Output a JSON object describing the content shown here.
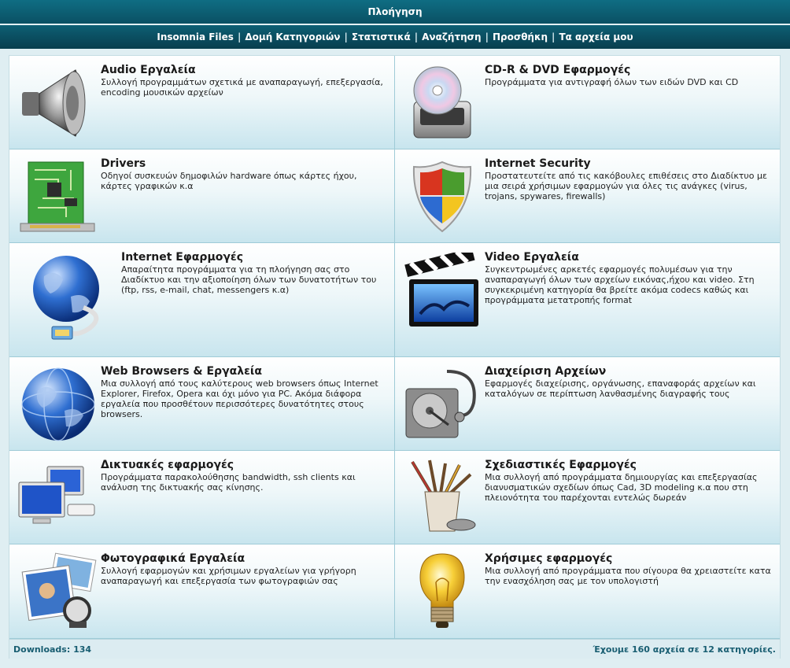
{
  "header": {
    "title": "Πλοήγηση"
  },
  "nav": {
    "items": [
      "Insomnia Files",
      "Δομή Κατηγοριών",
      "Στατιστικά",
      "Αναζήτηση",
      "Προσθήκη",
      "Τα αρχεία μου"
    ]
  },
  "categories": [
    {
      "title": "Audio Εργαλεία",
      "desc": "Συλλογή προγραμμάτων σχετικά με αναπαραγωγή, επεξεργασία, encoding μουσικών αρχείων",
      "icon": "speaker-icon"
    },
    {
      "title": "CD-R & DVD Εφαρμογές",
      "desc": "Προγράμματα για αντιγραφή όλων των ειδών DVD και CD",
      "icon": "cd-burner-icon"
    },
    {
      "title": "Drivers",
      "desc": "Οδηγοί συσκευών δημοφιλών hardware όπως κάρτες ήχου, κάρτες γραφικών κ.α",
      "icon": "circuit-board-icon"
    },
    {
      "title": "Internet Security",
      "desc": "Προστατευτείτε από τις κακόβουλες επιθέσεις στο Διαδίκτυο με μια σειρά χρήσιμων εφαρμογών για όλες τις ανάγκες (virus, trojans, spywares, firewalls)",
      "icon": "shield-icon"
    },
    {
      "title": "Internet Εφαρμογές",
      "desc": "Απαραίτητα προγράμματα για τη πλοήγηση σας στο Διαδίκτυο και την αξιοποίηση όλων των δυνατοτήτων του (ftp, rss, e-mail, chat, messengers κ.α)",
      "icon": "globe-cable-icon"
    },
    {
      "title": "Video Εργαλεία",
      "desc": "Συγκεντρωμένες αρκετές εφαρμογές πολυμέσων για την αναπαραγωγή όλων των αρχείων εικόνας,ήχου και video. Στη συγκεκριμένη κατηγορία θα βρείτε ακόμα codecs καθώς και προγράμματα μετατροπής format",
      "icon": "clapperboard-icon"
    },
    {
      "title": "Web Browsers & Εργαλεία",
      "desc": "Μια συλλογή από τους καλύτερους web browsers όπως Internet Explorer, Firefox, Opera και όχι μόνο για PC. Ακόμα διάφορα εργαλεία που προσθέτουν περισσότερες δυνατότητες στους browsers.",
      "icon": "globe-icon"
    },
    {
      "title": "Διαχείριση Αρχείων",
      "desc": "Εφαρμογές διαχείρισης, οργάνωσης, επαναφοράς αρχείων και καταλόγων σε περίπτωση λανθασμένης διαγραφής τους",
      "icon": "disk-stethoscope-icon"
    },
    {
      "title": "Δικτυακές εφαρμογές",
      "desc": "Προγράμματα παρακολούθησης bandwidth, ssh clients και ανάλυση της δικτυακής σας κίνησης.",
      "icon": "network-computers-icon"
    },
    {
      "title": "Σχεδιαστικές Εφαρμογές",
      "desc": "Μια συλλογή από προγράμματα δημιουργίας και επεξεργασίας διανυσματικών σχεδίων όπως Cad, 3D modeling κ.α που στη πλειονότητα του παρέχονται εντελώς δωρεάν",
      "icon": "pencil-cup-icon"
    },
    {
      "title": "Φωτογραφικά Εργαλεία",
      "desc": "Συλλογή εφαρμογών και χρήσιμων εργαλείων για γρήγορη αναπαραγωγή και επεξεργασία των φωτογραφιών σας",
      "icon": "photos-loupe-icon"
    },
    {
      "title": "Χρήσιμες εφαρμογές",
      "desc": "Μια συλλογή από προγράμματα που σίγουρα θα χρειαστείτε κατα την ενασχόληση σας με τον υπολογιστή",
      "icon": "light-bulb-icon"
    }
  ],
  "footer": {
    "downloads": "Downloads: 134",
    "summary": "Έχουμε 160 αρχεία σε 12 κατηγορίες."
  },
  "colors": {
    "header": "#0a5063",
    "footer_text": "#185d71",
    "cell_gradient_end": "#c8e5ee"
  }
}
